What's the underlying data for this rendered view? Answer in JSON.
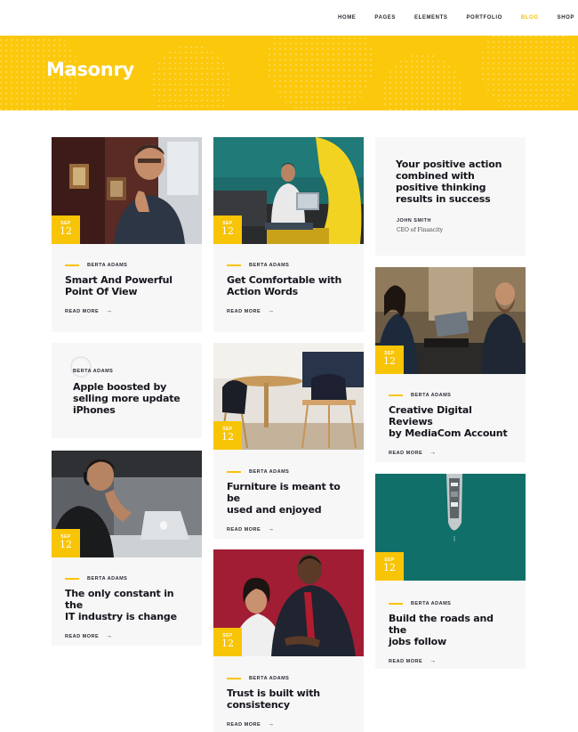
{
  "nav": {
    "items": [
      {
        "label": "HOME",
        "active": false
      },
      {
        "label": "PAGES",
        "active": false
      },
      {
        "label": "ELEMENTS",
        "active": false
      },
      {
        "label": "PORTFOLIO",
        "active": false
      },
      {
        "label": "BLOG",
        "active": true
      },
      {
        "label": "SHOP",
        "active": false
      }
    ]
  },
  "hero": {
    "title": "Masonry"
  },
  "colors": {
    "accent": "#fbc80b",
    "card_bg": "#f7f7f8",
    "active_nav": "#f5c20a"
  },
  "posts": [
    {
      "month": "SEP",
      "day": "12",
      "author": "BERTA ADAMS",
      "title_l1": "Smart And Powerful",
      "title_l2": "Point Of View",
      "more": "READ MORE"
    },
    {
      "month": "SEP",
      "day": "12",
      "author": "BERTA ADAMS",
      "title_l1": "Get Comfortable with",
      "title_l2": "Action Words",
      "more": "READ MORE"
    },
    {
      "author": "BERTA ADAMS",
      "title_l1": "Apple boosted by",
      "title_l2": "selling more update",
      "title_l3": "iPhones"
    },
    {
      "month": "SEP",
      "day": "12",
      "author": "BERTA ADAMS",
      "title_l1": "Furniture is meant to be",
      "title_l2": "used and enjoyed",
      "more": "READ MORE"
    },
    {
      "month": "SEP",
      "day": "12",
      "author": "BERTA ADAMS",
      "title_l1": "Creative Digital Reviews",
      "title_l2": "by MediaCom Account",
      "more": "READ MORE"
    },
    {
      "month": "SEP",
      "day": "12",
      "author": "BERTA ADAMS",
      "title_l1": "The only constant in the",
      "title_l2": "IT industry is change",
      "more": "READ MORE"
    },
    {
      "month": "SEP",
      "day": "12",
      "author": "BERTA ADAMS",
      "title_l1": "Trust is built with",
      "title_l2": "consistency",
      "more": "READ MORE"
    },
    {
      "month": "SEP",
      "day": "12",
      "author": "BERTA ADAMS",
      "title_l1": "Build the roads and the",
      "title_l2": "jobs follow",
      "more": "READ MORE"
    }
  ],
  "quote": {
    "l1": "Your positive action",
    "l2": "combined with",
    "l3": "positive thinking",
    "l4": "results in success",
    "name": "JOHN SMITH",
    "role": "CEO of Financity"
  }
}
